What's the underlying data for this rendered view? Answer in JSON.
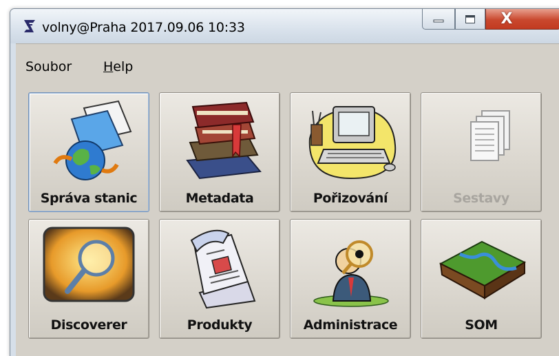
{
  "window": {
    "title": "volny@Praha 2017.09.06 10:33",
    "icon": "app-logo-icon",
    "controls": {
      "minimize": "minimize-icon",
      "maximize": "maximize-icon",
      "close": "X"
    }
  },
  "menu": {
    "soubor": "Soubor",
    "help_first": "H",
    "help_rest": "elp"
  },
  "tiles": [
    {
      "label": "Správa stanic",
      "icon": "globe-folder-icon",
      "enabled": true,
      "selected": true
    },
    {
      "label": "Metadata",
      "icon": "books-icon",
      "enabled": true
    },
    {
      "label": "Pořizování",
      "icon": "computer-icon",
      "enabled": true
    },
    {
      "label": "Sestavy",
      "icon": "documents-icon",
      "enabled": false
    },
    {
      "label": "Discoverer",
      "icon": "magnifier-icon",
      "enabled": true
    },
    {
      "label": "Produkty",
      "icon": "newspaper-icon",
      "enabled": true
    },
    {
      "label": "Administrace",
      "icon": "inspector-icon",
      "enabled": true
    },
    {
      "label": "SOM",
      "icon": "terrain-icon",
      "enabled": true
    }
  ]
}
